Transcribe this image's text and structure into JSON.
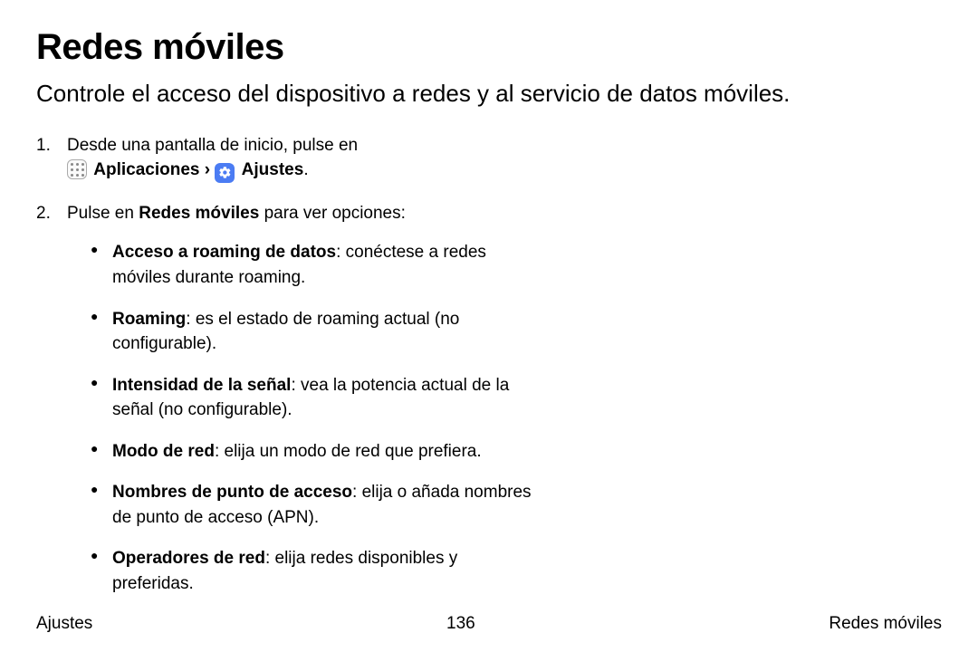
{
  "title": "Redes móviles",
  "subtitle": "Controle el acceso del dispositivo a redes y al servicio de datos móviles.",
  "step1": {
    "pre": "Desde una pantalla de inicio, pulse en",
    "apps_label": "Aplicaciones",
    "chevron": "›",
    "settings_label": "Ajustes",
    "period": "."
  },
  "step2": {
    "pre": "Pulse en ",
    "bold": "Redes móviles",
    "post": " para ver opciones:"
  },
  "bullets": [
    {
      "term": "Acceso a roaming de datos",
      "desc": ": conéctese a redes móviles durante roaming."
    },
    {
      "term": "Roaming",
      "desc": ": es el estado de roaming actual (no configurable)."
    },
    {
      "term": "Intensidad de la señal",
      "desc": ": vea la potencia actual de la señal (no configurable)."
    },
    {
      "term": "Modo de red",
      "desc": ": elija un modo de red que prefiera."
    },
    {
      "term": "Nombres de punto de acceso",
      "desc": ": elija o añada nombres de punto de acceso (APN)."
    },
    {
      "term": "Operadores de red",
      "desc": ": elija redes disponibles y preferidas."
    }
  ],
  "footer": {
    "left": "Ajustes",
    "center": "136",
    "right": "Redes móviles"
  }
}
